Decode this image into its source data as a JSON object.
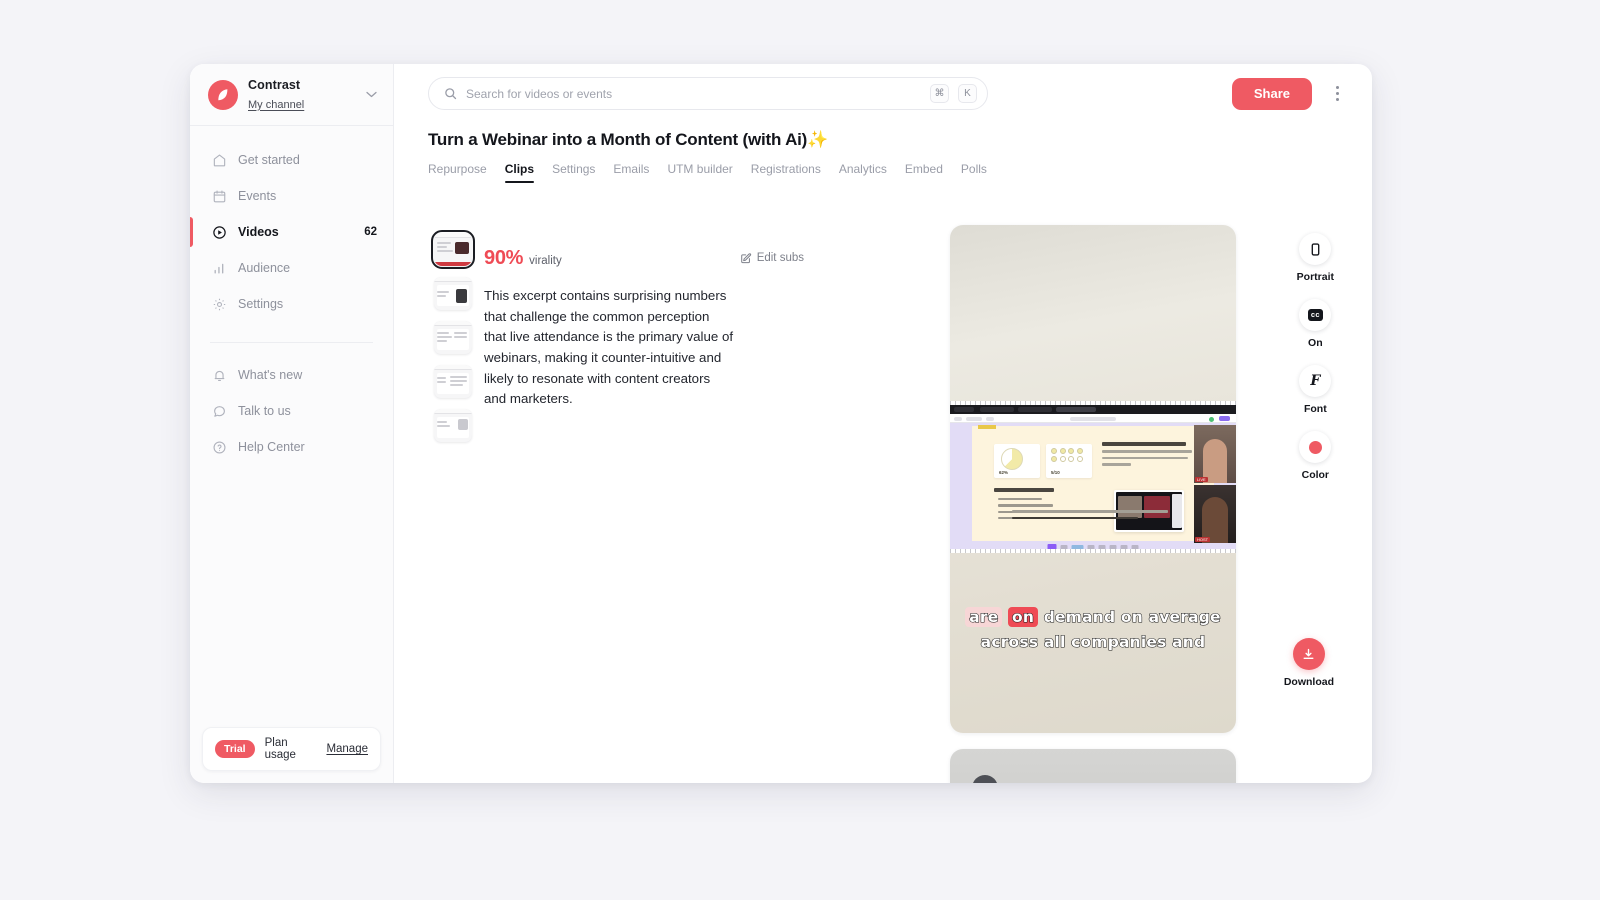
{
  "brand": {
    "name": "Contrast",
    "channel": "My channel",
    "logo_icon": "contrast-logo-icon",
    "caret_icon": "chevron-down-icon",
    "accent_color": "#ef5a63"
  },
  "sidebar": {
    "items": [
      {
        "label": "Get started",
        "icon": "home-icon",
        "active": false,
        "count": ""
      },
      {
        "label": "Events",
        "icon": "calendar-icon",
        "active": false,
        "count": ""
      },
      {
        "label": "Videos",
        "icon": "play-circle-icon",
        "active": true,
        "count": "62"
      },
      {
        "label": "Audience",
        "icon": "bar-chart-icon",
        "active": false,
        "count": ""
      },
      {
        "label": "Settings",
        "icon": "gear-icon",
        "active": false,
        "count": ""
      }
    ],
    "secondary_items": [
      {
        "label": "What's new",
        "icon": "bell-icon"
      },
      {
        "label": "Talk to us",
        "icon": "chat-bubble-icon"
      },
      {
        "label": "Help Center",
        "icon": "question-circle-icon"
      }
    ],
    "plan": {
      "badge": "Trial",
      "label": "Plan usage",
      "manage": "Manage"
    }
  },
  "topbar": {
    "search_placeholder": "Search for videos or events",
    "search_value": "",
    "search_icon": "search-icon",
    "shortcut_keys": [
      "⌘",
      "K"
    ],
    "share_label": "Share",
    "kebab_icon": "more-vertical-icon"
  },
  "page": {
    "title": "Turn a Webinar into a Month of Content (with Ai)",
    "title_sparkle": "✨",
    "tabs": [
      {
        "label": "Repurpose",
        "active": false
      },
      {
        "label": "Clips",
        "active": true
      },
      {
        "label": "Settings",
        "active": false
      },
      {
        "label": "Emails",
        "active": false
      },
      {
        "label": "UTM builder",
        "active": false
      },
      {
        "label": "Registrations",
        "active": false
      },
      {
        "label": "Analytics",
        "active": false
      },
      {
        "label": "Embed",
        "active": false
      },
      {
        "label": "Polls",
        "active": false
      }
    ]
  },
  "clip": {
    "virality_score": "90%",
    "virality_word": "virality",
    "edit_subs_label": "Edit subs",
    "edit_subs_icon": "pencil-square-icon",
    "description": "This excerpt contains surprising numbers that challenge the common perception that live attendance is the primary value of webinars, making it counter-intuitive and likely to resonate with content creators and marketers.",
    "thumbnails": [
      {
        "index": 1,
        "selected": true
      },
      {
        "index": 2,
        "selected": false
      },
      {
        "index": 3,
        "selected": false
      },
      {
        "index": 4,
        "selected": false
      },
      {
        "index": 5,
        "selected": false
      }
    ],
    "captions": {
      "line1_pre": "are",
      "line1_hl": "on",
      "line1_post": "demand on average",
      "line2": "across all companies and",
      "highlight_soft_color": "#f7d6d6",
      "highlight_strong_color": "#ef4b55"
    }
  },
  "tools": [
    {
      "label": "Portrait",
      "icon": "phone-portrait-icon"
    },
    {
      "label": "On",
      "icon": "closed-caption-icon",
      "glyph": "cc"
    },
    {
      "label": "Font",
      "icon": "font-icon",
      "glyph": "F"
    },
    {
      "label": "Color",
      "icon": "color-swatch-icon",
      "value": "#ef5a63"
    }
  ],
  "download": {
    "label": "Download",
    "icon": "download-icon"
  }
}
